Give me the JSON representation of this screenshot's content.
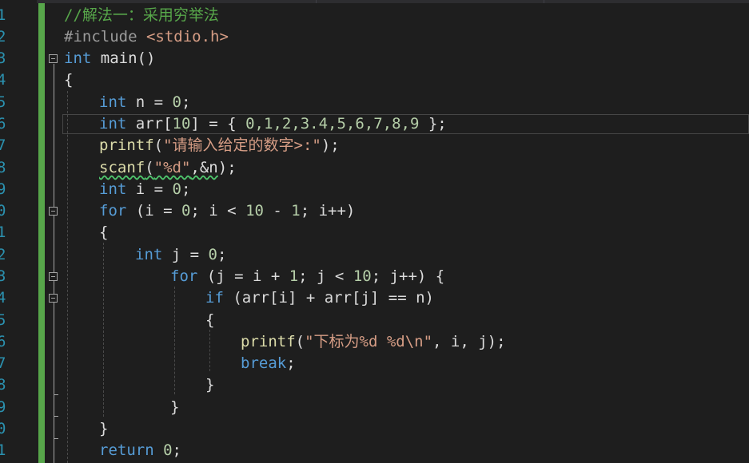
{
  "line_numbers": [
    "1",
    "2",
    "3",
    "4",
    "5",
    "6",
    "7",
    "8",
    "9",
    "0",
    "1",
    "2",
    "3",
    "4",
    "5",
    "6",
    "7",
    "8",
    "9",
    "0",
    "1"
  ],
  "code": {
    "l1_comment": "//解法一：采用穷举法",
    "l2_include": "#include ",
    "l2_header": "<stdio.h>",
    "l3_int": "int",
    "l3_main": " main()",
    "l4": "{",
    "l5_int": "int",
    "l5_rest": " n = ",
    "l5_num": "0",
    "l5_end": ";",
    "l6_int": "int",
    "l6_rest": " arr[",
    "l6_num": "10",
    "l6_mid": "] = { ",
    "l6_vals": "0,1,2,3.4,5,6,7,8,9",
    "l6_end": " };",
    "l7_fn": "printf",
    "l7_open": "(",
    "l7_str": "\"请输入给定的数字>:\"",
    "l7_end": ");",
    "l8_fn": "scanf",
    "l8_open": "(",
    "l8_str": "\"%d\"",
    "l8_rest": ",&n",
    "l8_end": ");",
    "l9_int": "int",
    "l9_rest": " i = ",
    "l9_num": "0",
    "l9_end": ";",
    "l10_for": "for",
    "l10_a": " (i = ",
    "l10_n0": "0",
    "l10_b": "; i < ",
    "l10_n10": "10",
    "l10_c": " - ",
    "l10_n1": "1",
    "l10_d": "; i++)",
    "l11": "{",
    "l12_int": "int",
    "l12_rest": " j = ",
    "l12_num": "0",
    "l12_end": ";",
    "l13_for": "for",
    "l13_a": " (j = i + ",
    "l13_n1": "1",
    "l13_b": "; j < ",
    "l13_n10": "10",
    "l13_c": "; j++) {",
    "l14_if": "if",
    "l14_rest": " (arr[i] + arr[j] == n)",
    "l15": "{",
    "l16_fn": "printf",
    "l16_open": "(",
    "l16_str": "\"下标为%d %d\\n\"",
    "l16_rest": ", i, j);",
    "l17_break": "break",
    "l17_end": ";",
    "l18": "}",
    "l19": "}",
    "l20": "}",
    "l21_return": "return",
    "l21_sp": " ",
    "l21_num": "0",
    "l21_end": ";"
  },
  "colors": {
    "background": "#1e1e1e",
    "keyword": "#569cd6",
    "string": "#d69d85",
    "comment": "#57a64a",
    "line_number": "#2b91af",
    "number": "#b5cea8",
    "change_bar": "#57a64a"
  }
}
